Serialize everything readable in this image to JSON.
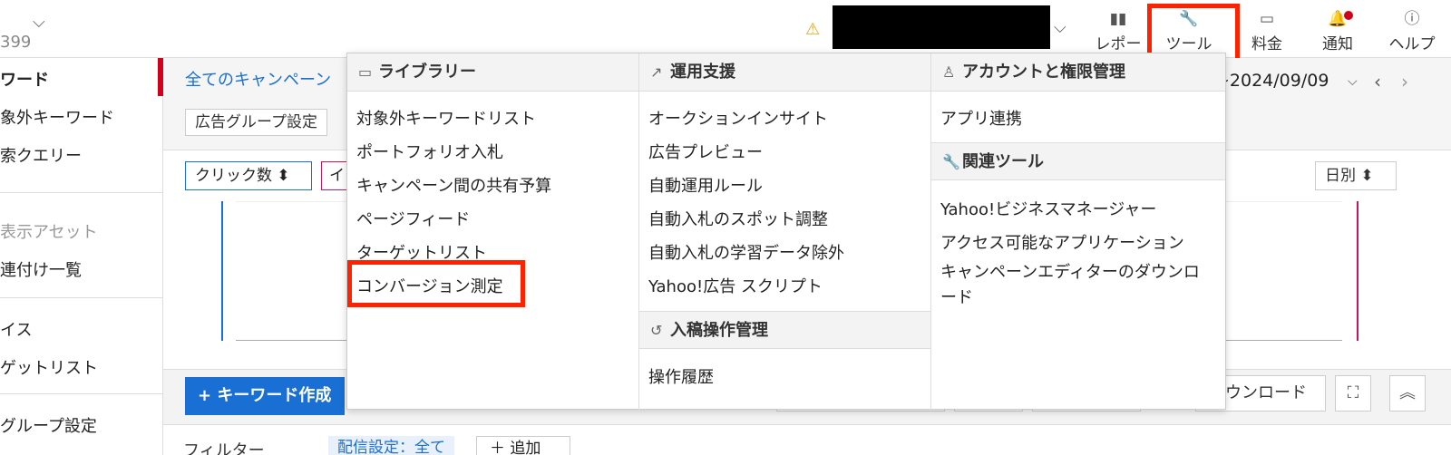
{
  "account": {
    "number_fragment": "399",
    "user_name_redacted": ""
  },
  "nav": {
    "report": "レポー",
    "tools": "ツール",
    "billing": "料金",
    "notify": "通知",
    "help": "ヘルプ"
  },
  "sidebar": {
    "items": [
      "ワード",
      "象外キーワード",
      "索クエリー",
      "表示アセット",
      "連付け一覧",
      "イス",
      "ゲットリスト",
      "グループ設定"
    ]
  },
  "main": {
    "all_campaigns": "全てのキャンペーン",
    "adgroup_settings": "広告グループ設定",
    "date_range": "~2024/09/09",
    "metric1": "クリック数 ⬍",
    "metric2": "イ",
    "daily": "日別 ⬍",
    "create_keyword": "+ キーワード作成",
    "download": "ダウンロード",
    "filter_label": "フィルター",
    "filter_chip": "配信設定：全て",
    "add_label": "＋ 追加"
  },
  "dropdown": {
    "library": {
      "title": "ライブラリー",
      "items": [
        "対象外キーワードリスト",
        "ポートフォリオ入札",
        "キャンペーン間の共有予算",
        "ページフィード",
        "ターゲットリスト",
        "コンバージョン測定"
      ]
    },
    "ops": {
      "title": "運用支援",
      "items": [
        "オークションインサイト",
        "広告プレビュー",
        "自動運用ルール",
        "自動入札のスポット調整",
        "自動入札の学習データ除外",
        "Yahoo!広告 スクリプト"
      ]
    },
    "submission": {
      "title": "入稿操作管理",
      "items": [
        "操作履歴"
      ]
    },
    "account": {
      "title": "アカウントと権限管理",
      "items": [
        "アプリ連携"
      ]
    },
    "related": {
      "title": "関連ツール",
      "items": [
        "Yahoo!ビジネスマネージャー",
        "アクセス可能なアプリケーション",
        "キャンペーンエディターのダウンロード"
      ]
    }
  },
  "colors": {
    "accent": "#1a6fd4",
    "highlight": "#ff2200",
    "brand_red": "#d0021b"
  }
}
